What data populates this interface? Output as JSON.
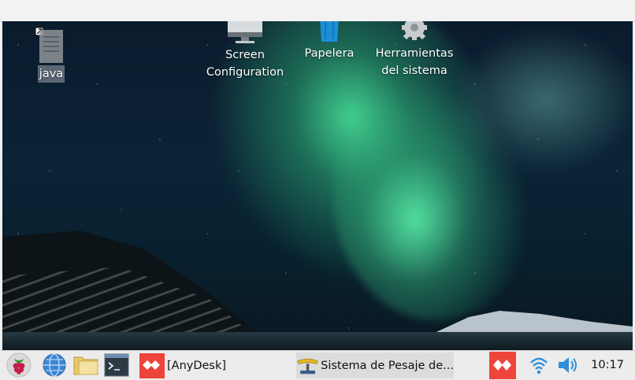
{
  "desktop": {
    "icons": [
      {
        "label_lines": [
          "java"
        ],
        "icon": "text-file-icon"
      },
      {
        "label_lines": [
          "Screen",
          "Configuration"
        ],
        "icon": "monitor-icon"
      },
      {
        "label_lines": [
          "Papelera"
        ],
        "icon": "trash-icon"
      },
      {
        "label_lines": [
          "Herramientas",
          "del sistema"
        ],
        "icon": "gear-icon"
      }
    ]
  },
  "taskbar": {
    "launchers": [
      {
        "icon": "raspberry-menu-icon"
      },
      {
        "icon": "web-browser-globe-icon"
      },
      {
        "icon": "file-manager-folder-icon"
      },
      {
        "icon": "terminal-icon"
      }
    ],
    "tasks": [
      {
        "label": "[AnyDesk]",
        "icon": "anydesk-icon"
      },
      {
        "label": "Sistema de Pesaje de...",
        "icon": "scale-icon"
      }
    ],
    "tray": [
      {
        "icon": "anydesk-tray-icon"
      },
      {
        "icon": "wifi-icon"
      },
      {
        "icon": "volume-icon"
      }
    ],
    "clock": "10:17"
  },
  "colors": {
    "anydesk_red": "#ef443b",
    "panel_bg": "#ececec",
    "tray_blue": "#2f8fd8"
  }
}
